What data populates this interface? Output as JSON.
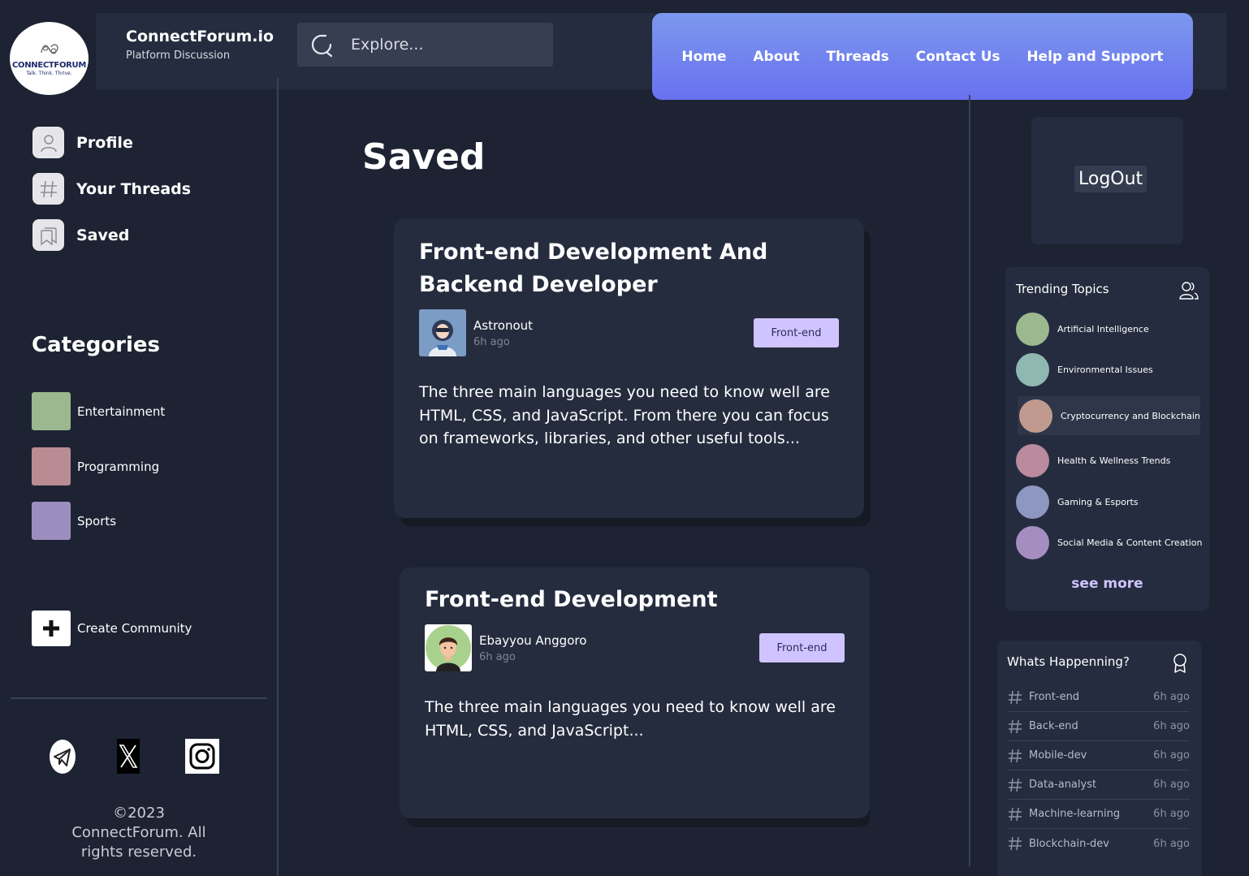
{
  "brand": {
    "logo_name": "CONNECTFORUM",
    "logo_tagline": "Talk. Think. Thrive.",
    "name": "ConnectForum.io",
    "subtitle": "Platform Discussion"
  },
  "search": {
    "placeholder": "Explore..."
  },
  "nav": {
    "items": [
      "Home",
      "About",
      "Threads",
      "Contact Us",
      "Help and Support"
    ]
  },
  "sidebar": {
    "menu": [
      {
        "label": "Profile",
        "icon": "user-icon"
      },
      {
        "label": "Your Threads",
        "icon": "hash-icon"
      },
      {
        "label": "Saved",
        "icon": "bookmark-icon"
      }
    ],
    "categories_title": "Categories",
    "categories": [
      {
        "label": "Entertainment",
        "color": "#9bb88f"
      },
      {
        "label": "Programming",
        "color": "#b98b93"
      },
      {
        "label": "Sports",
        "color": "#9b8ebf"
      }
    ],
    "create_label": "Create Community",
    "socials": [
      "telegram-icon",
      "x-icon",
      "instagram-icon"
    ],
    "copyright": "©2023 ConnectForum. All rights reserved."
  },
  "main": {
    "title": "Saved",
    "posts": [
      {
        "title": "Front-end Development And Backend Developer",
        "author": "Astronout",
        "time": "6h ago",
        "tag": "Front-end",
        "body": "The three main languages you need to know well are HTML, CSS, and JavaScript. From there you can focus on frameworks, libraries, and other useful tools..."
      },
      {
        "title": "Front-end Development",
        "author": "Ebayyou Anggoro",
        "time": "6h ago",
        "tag": "Front-end",
        "body": "The three main languages you need to know well are HTML, CSS, and JavaScript..."
      }
    ]
  },
  "right": {
    "logout_label": "LogOut",
    "trending_title": "Trending Topics",
    "topics": [
      {
        "label": "Artificial Intelligence",
        "color": "#9bb88f"
      },
      {
        "label": "Environmental Issues",
        "color": "#8fb8b3"
      },
      {
        "label": "Cryptocurrency and Blockchain",
        "color": "#c09a8e"
      },
      {
        "label": "Health & Wellness Trends",
        "color": "#b98b9d"
      },
      {
        "label": "Gaming & Esports",
        "color": "#8e97bf"
      },
      {
        "label": "Social Media & Content Creation",
        "color": "#a58ebf"
      }
    ],
    "see_more": "see more",
    "happening_title": "Whats Happenning?",
    "happenings": [
      {
        "label": "Front-end",
        "time": "6h ago"
      },
      {
        "label": "Back-end",
        "time": "6h ago"
      },
      {
        "label": "Mobile-dev",
        "time": "6h ago"
      },
      {
        "label": "Data-analyst",
        "time": "6h ago"
      },
      {
        "label": "Machine-learning",
        "time": "6h ago"
      },
      {
        "label": "Blockchain-dev",
        "time": "6h ago"
      }
    ]
  },
  "colors": {
    "background": "#1d2333",
    "panel": "#252c3f",
    "accent_gradient_start": "#7b98ee",
    "accent_gradient_end": "#6971ef",
    "tag_bg": "#cfc4ff"
  }
}
